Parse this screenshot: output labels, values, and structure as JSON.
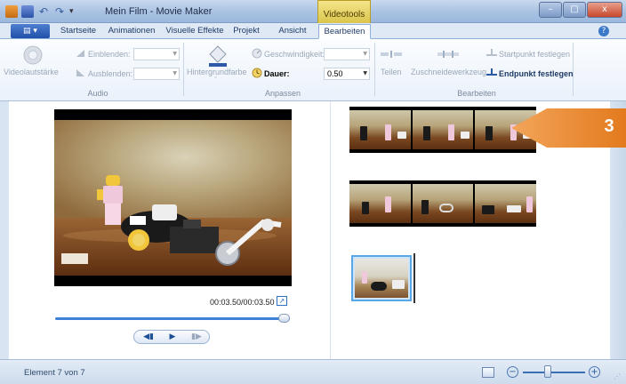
{
  "window": {
    "title": "Mein Film - Movie Maker",
    "contextual_group": "Videotools",
    "minimize": "–",
    "maximize": "□",
    "close": "x",
    "qat_dropdown": "▾"
  },
  "tabs": [
    {
      "label": "Startseite",
      "active": false
    },
    {
      "label": "Animationen",
      "active": false
    },
    {
      "label": "Visuelle Effekte",
      "active": false
    },
    {
      "label": "Projekt",
      "active": false
    },
    {
      "label": "Ansicht",
      "active": false
    },
    {
      "label": "Bearbeiten",
      "active": true
    }
  ],
  "app_menu_label": "▤ ▾",
  "help": "?",
  "ribbon": {
    "audio": {
      "group_label": "Audio",
      "volume_label": "Videolautstärke",
      "fade_in_label": "Einblenden:",
      "fade_out_label": "Ausblenden:"
    },
    "adjust": {
      "group_label": "Anpassen",
      "background_color_label": "Hintergrundfarbe",
      "speed_label": "Geschwindigkeit:",
      "duration_label": "Dauer:",
      "duration_value": "0.50"
    },
    "edit": {
      "group_label": "Bearbeiten",
      "split_label": "Teilen",
      "trim_tool_label": "Zuschneidewerkzeug",
      "set_start_label": "Startpunkt festlegen",
      "set_end_label": "Endpunkt festlegen"
    }
  },
  "preview": {
    "time": "00:03.50/00:03.50",
    "seek_progress": 1.0,
    "fullscreen_glyph": "↗",
    "prev_glyph": "◀▮",
    "play_glyph": "▶",
    "next_glyph": "▮▶"
  },
  "storyboard": {
    "callout_number": "3"
  },
  "status": {
    "text": "Element 7 von 7",
    "zoom_out": "−",
    "zoom_in": "+",
    "grip": "⋰"
  },
  "colors": {
    "accent_blue": "#3d82d4",
    "callout_orange": "#e8892e",
    "contextual_yellow": "#e9d66a"
  }
}
